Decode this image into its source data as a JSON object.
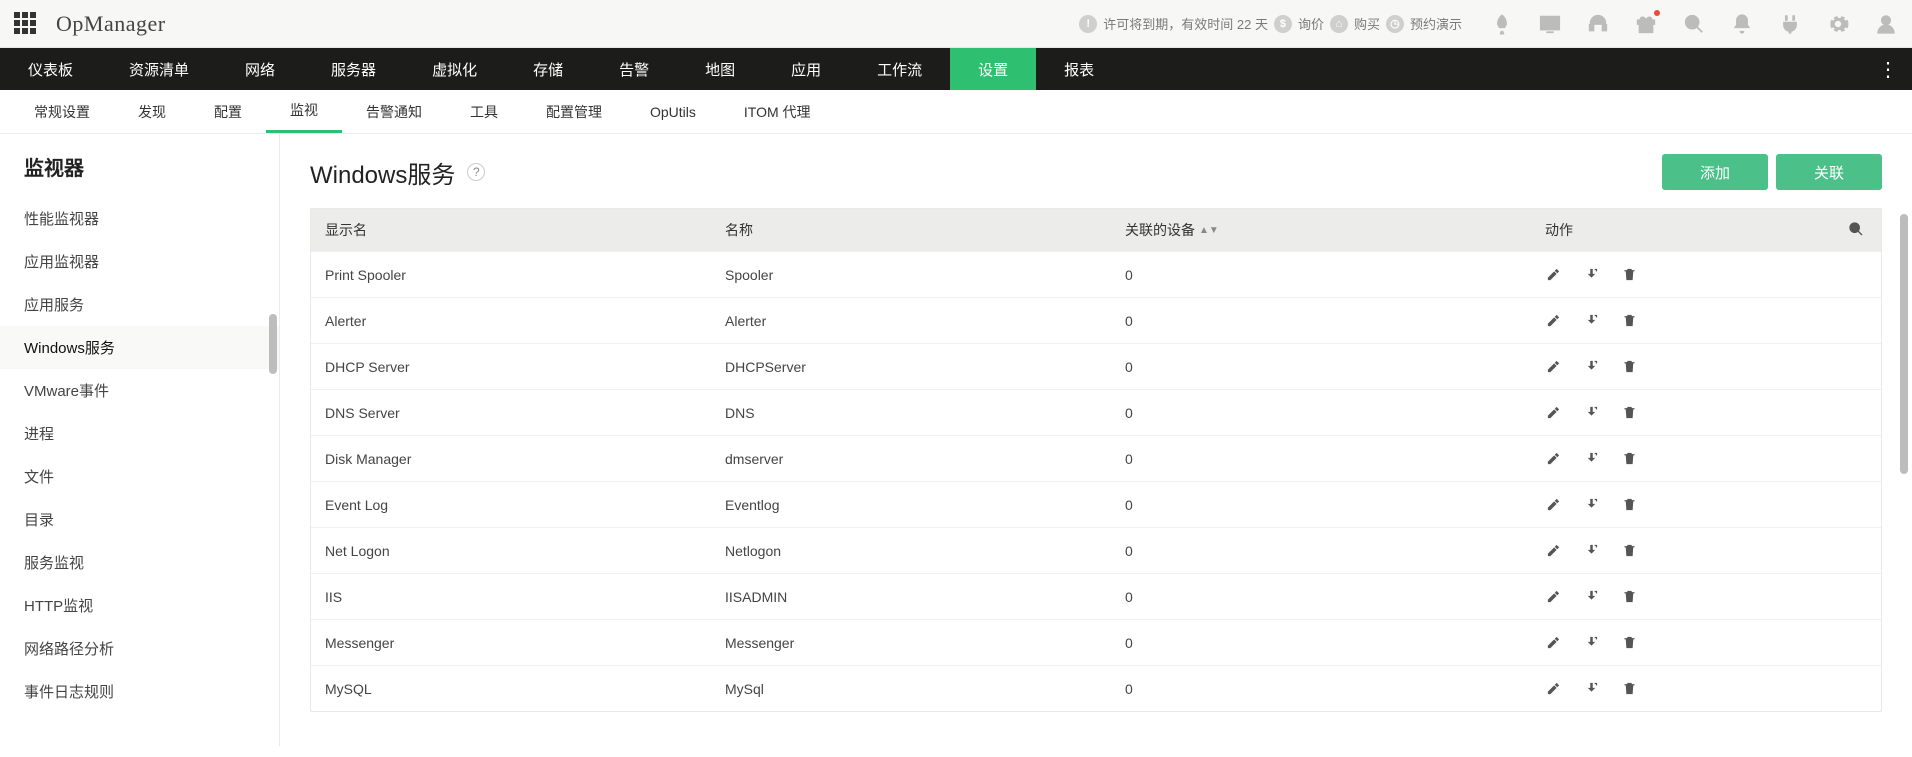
{
  "header": {
    "product_name": "OpManager",
    "license_text": "许可将到期，有效时间 22 天",
    "link_quote": "询价",
    "link_buy": "购买",
    "link_demo": "预约演示"
  },
  "mainnav": {
    "items": [
      "仪表板",
      "资源清单",
      "网络",
      "服务器",
      "虚拟化",
      "存储",
      "告警",
      "地图",
      "应用",
      "工作流",
      "设置",
      "报表"
    ],
    "active_index": 10
  },
  "subnav": {
    "items": [
      "常规设置",
      "发现",
      "配置",
      "监视",
      "告警通知",
      "工具",
      "配置管理",
      "OpUtils",
      "ITOM 代理"
    ],
    "active_index": 3
  },
  "sidebar": {
    "title": "监视器",
    "items": [
      "性能监视器",
      "应用监视器",
      "应用服务",
      "Windows服务",
      "VMware事件",
      "进程",
      "文件",
      "目录",
      "服务监视",
      "HTTP监视",
      "网络路径分析",
      "事件日志规则"
    ],
    "active_index": 3
  },
  "page": {
    "title": "Windows服务",
    "add_label": "添加",
    "assoc_label": "关联"
  },
  "table": {
    "columns": {
      "display_name": "显示名",
      "name": "名称",
      "devices": "关联的设备",
      "actions": "动作"
    },
    "rows": [
      {
        "display": "Print Spooler",
        "name": "Spooler",
        "devices": "0"
      },
      {
        "display": "Alerter",
        "name": "Alerter",
        "devices": "0"
      },
      {
        "display": "DHCP Server",
        "name": "DHCPServer",
        "devices": "0"
      },
      {
        "display": "DNS Server",
        "name": "DNS",
        "devices": "0"
      },
      {
        "display": "Disk Manager",
        "name": "dmserver",
        "devices": "0"
      },
      {
        "display": "Event Log",
        "name": "Eventlog",
        "devices": "0"
      },
      {
        "display": "Net Logon",
        "name": "Netlogon",
        "devices": "0"
      },
      {
        "display": "IIS",
        "name": "IISADMIN",
        "devices": "0"
      },
      {
        "display": "Messenger",
        "name": "Messenger",
        "devices": "0"
      },
      {
        "display": "MySQL",
        "name": "MySql",
        "devices": "0"
      }
    ]
  }
}
